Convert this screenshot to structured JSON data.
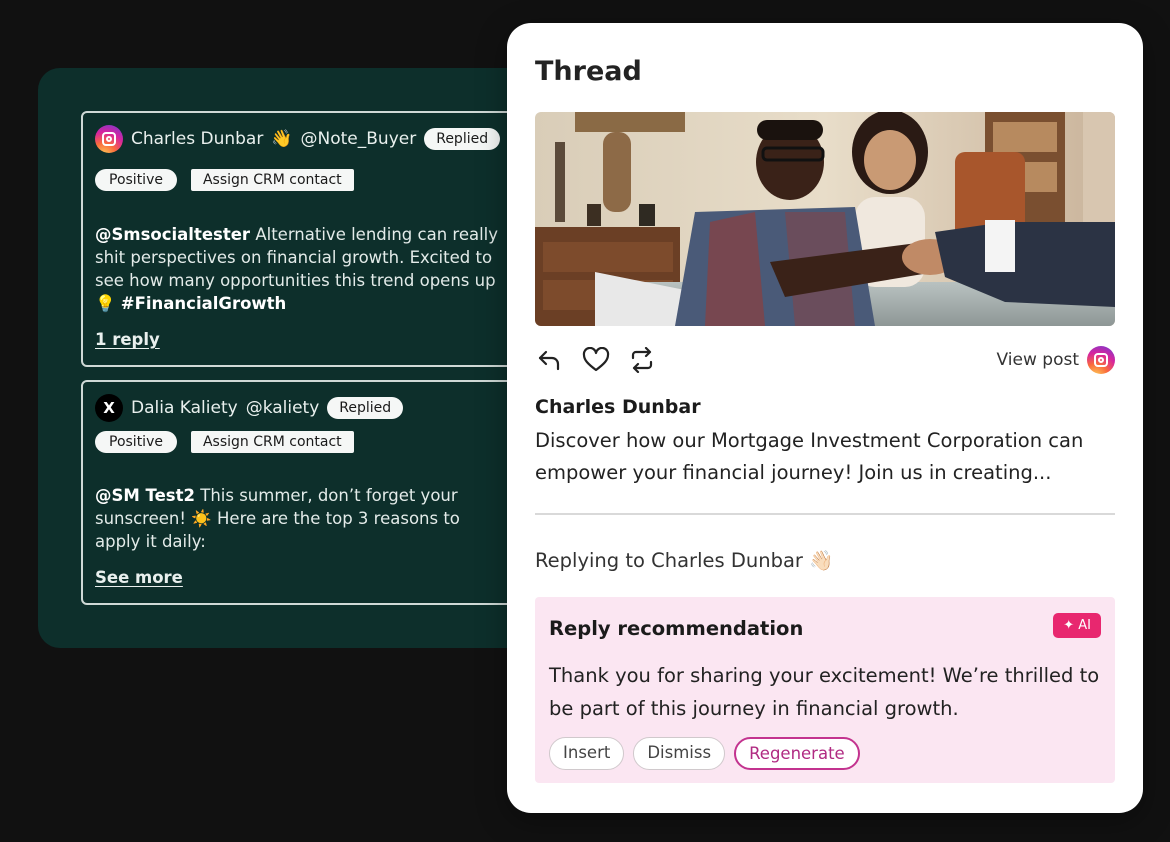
{
  "messages": [
    {
      "network_icon": "instagram-icon",
      "author": "Charles Dunbar",
      "emoji": "👋",
      "handle": "@Note_Buyer",
      "status": "Replied",
      "sentiment": "Positive",
      "crm_action": "Assign CRM contact",
      "mention": "@Smsocialtester",
      "line1_rest": " Alternative lending can really",
      "line2": "shit perspectives on financial growth. Excited to",
      "line3": "see how many opportunities this trend opens up",
      "line4_emoji": "💡",
      "hashtag": "#FinancialGrowth",
      "link": "1 reply"
    },
    {
      "network_icon": "x-icon",
      "network_glyph": "X",
      "author": "Dalia Kaliety",
      "handle": "@kaliety",
      "status": "Replied",
      "sentiment": "Positive",
      "crm_action": "Assign CRM contact",
      "mention": "@SM Test2",
      "line1_rest": " This summer, don’t forget your",
      "line2": "sunscreen! ☀️ Here are the top 3 reasons to",
      "line3": "apply it daily:",
      "link": "See more"
    }
  ],
  "thread": {
    "title": "Thread",
    "view_post": "View post",
    "author": "Charles Dunbar",
    "post_text": "Discover how our Mortgage Investment Corporation can empower your financial journey! Join us in creating...",
    "replying_to": "Replying to Charles Dunbar 👋🏻",
    "recommendation": {
      "title": "Reply recommendation",
      "badge": "✦ AI",
      "text": "Thank you for sharing your excitement! We’re thrilled to be part of this journey in financial growth.",
      "actions": [
        "Insert",
        "Dismiss",
        "Regenerate"
      ]
    }
  },
  "colors": {
    "panel_bg": "#0d2f2b",
    "ai_accent": "#e8276f",
    "regenerate_accent": "#c3338f",
    "recommendation_bg": "#fbe6f2"
  }
}
